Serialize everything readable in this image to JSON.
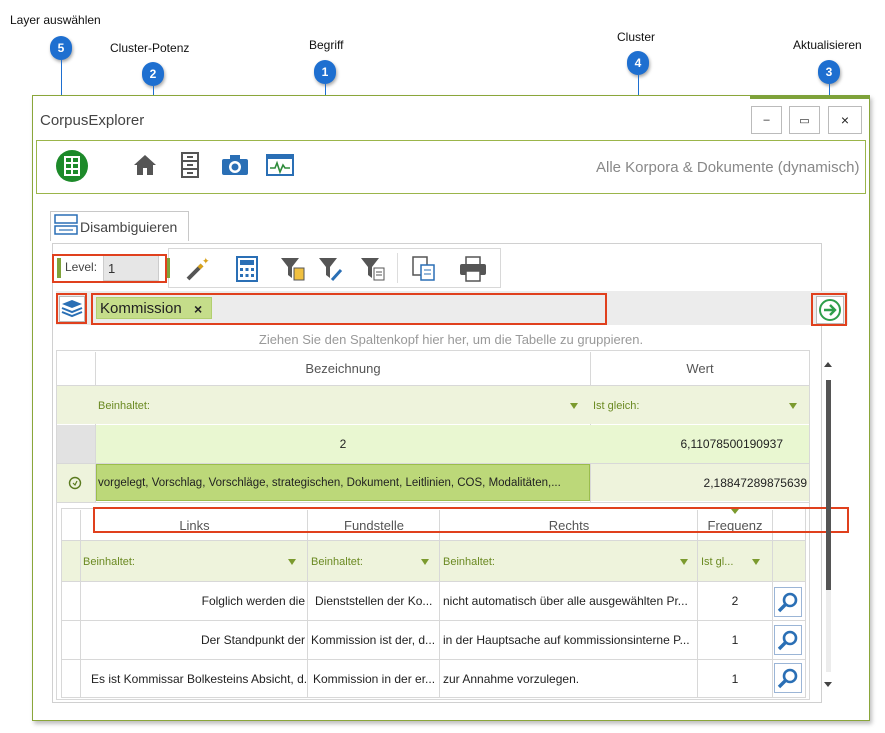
{
  "callouts": [
    {
      "num": "5",
      "label": "Layer auswählen"
    },
    {
      "num": "2",
      "label": "Cluster-Potenz"
    },
    {
      "num": "1",
      "label": "Begriff"
    },
    {
      "num": "4",
      "label": "Cluster"
    },
    {
      "num": "3",
      "label": "Aktualisieren"
    }
  ],
  "window": {
    "title": "CorpusExplorer",
    "minimize": "–",
    "maximize": "▭",
    "close": "×",
    "corpus_label": "Alle Korpora & Dokumente (dynamisch)"
  },
  "ribbon_icons": [
    "corpus-icon",
    "home-icon",
    "cabinet-icon",
    "camera-icon",
    "monitor-icon"
  ],
  "tab": {
    "label": "Disambiguieren"
  },
  "level": {
    "label": "Level:",
    "value": "1"
  },
  "toolbar_icons": [
    "magic-wand-icon",
    "calculator-icon",
    "filter-clipboard-icon",
    "filter-wrench-icon",
    "filter-document-icon",
    "export-icon",
    "print-icon"
  ],
  "search": {
    "term": "Kommission",
    "remove": "×"
  },
  "hint": "Ziehen Sie den Spaltenkopf hier her, um die Tabelle zu gruppieren.",
  "grid": {
    "columns": [
      "Bezeichnung",
      "Wert"
    ],
    "filters": [
      "Beinhaltet:",
      "Ist gleich:"
    ],
    "rows": [
      {
        "bezeichnung": "2",
        "wert": "6,11078500190937"
      },
      {
        "bezeichnung": "vorgelegt, Vorschlag, Vorschläge, strategischen, Dokument, Leitlinien, COS, Modalitäten,...",
        "wert": "2,18847289875639"
      }
    ]
  },
  "subgrid": {
    "columns": [
      "Links",
      "Fundstelle",
      "Rechts",
      "Frequenz"
    ],
    "filters": [
      "Beinhaltet:",
      "Beinhaltet:",
      "Beinhaltet:",
      "Ist gl..."
    ],
    "rows": [
      {
        "links": "Folglich werden die",
        "fundstelle": "Dienststellen der Ko...",
        "rechts": "nicht automatisch über alle ausgewählten Pr...",
        "frequenz": "2"
      },
      {
        "links": "Der Standpunkt der",
        "fundstelle": "Kommission ist der, d...",
        "rechts": "in der Hauptsache auf kommissionsinterne P...",
        "frequenz": "1"
      },
      {
        "links": "Es ist Kommissar Bolkesteins Absicht, d...",
        "fundstelle": "Kommission in der er...",
        "rechts": "zur Annahme vorzulegen.",
        "frequenz": "1"
      }
    ]
  },
  "colors": {
    "accent": "#1e6fd0",
    "highlight": "#e0401d",
    "brand_green": "#7ea23a"
  }
}
